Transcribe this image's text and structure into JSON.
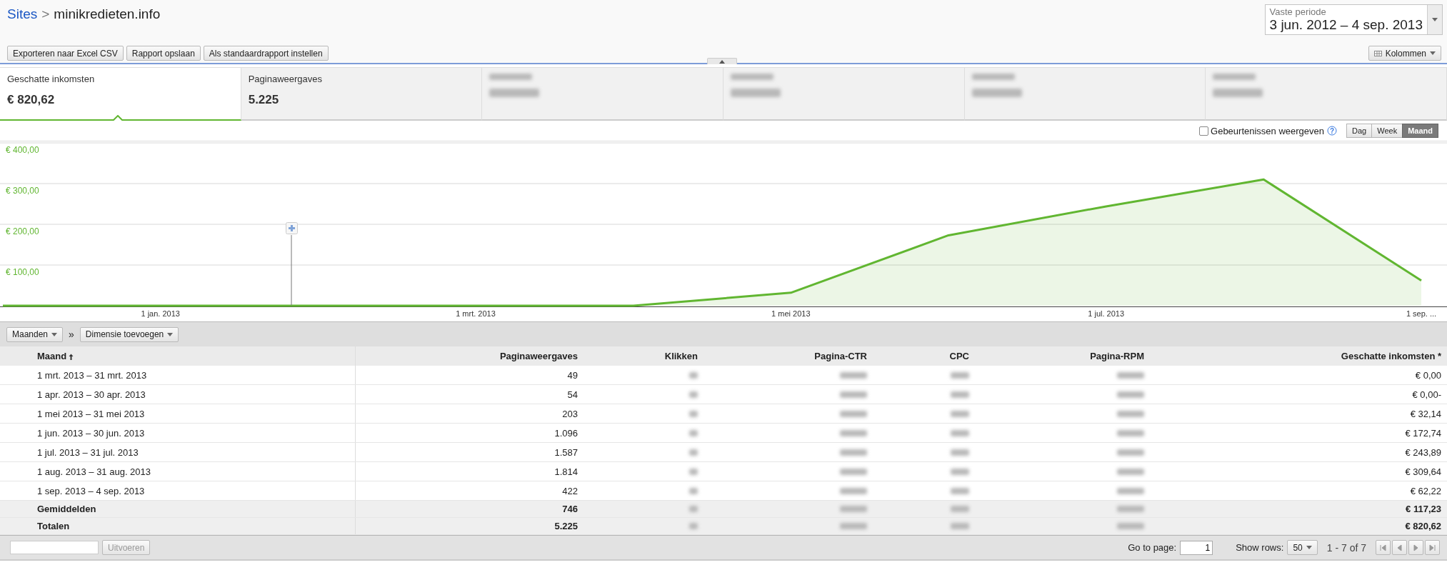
{
  "breadcrumb": {
    "link": "Sites",
    "separator": ">",
    "current": "minikredieten.info"
  },
  "toolbar_buttons": [
    "Exporteren naar Excel CSV",
    "Rapport opslaan",
    "Als standaardrapport instellen"
  ],
  "date_range": {
    "label": "Vaste periode",
    "value": "3 jun. 2012 – 4 sep. 2013"
  },
  "columns_button": "Kolommen",
  "metric_tabs": [
    {
      "kind": "metric",
      "label": "Geschatte inkomsten",
      "value": "€ 820,62",
      "selected": true
    },
    {
      "kind": "metric",
      "label": "Paginaweergaves",
      "value": "5.225",
      "selected": false
    },
    {
      "kind": "redacted",
      "selected": false
    },
    {
      "kind": "redacted",
      "selected": false
    },
    {
      "kind": "redacted",
      "selected": false
    },
    {
      "kind": "redacted",
      "selected": false
    }
  ],
  "chart_toolbar": {
    "events_checkbox": {
      "label": "Gebeurtenissen weergeven",
      "checked": false
    },
    "granularity": [
      {
        "label": "Dag",
        "selected": false
      },
      {
        "label": "Week",
        "selected": false
      },
      {
        "label": "Maand",
        "selected": true
      }
    ],
    "help_icon": "?"
  },
  "chart": {
    "chart_data": {
      "type": "area",
      "categories": [
        null,
        "1 jan. 2013",
        null,
        "1 mrt. 2013",
        null,
        "1 mei 2013",
        null,
        "1 jul. 2013",
        null,
        "1 sep. ..."
      ],
      "series": [
        {
          "color": "#61b631",
          "values": [
            0,
            0,
            0,
            0,
            0,
            32,
            173,
            244,
            310,
            62
          ]
        }
      ],
      "ylim": [
        0,
        400
      ],
      "grid": true,
      "yticks": [
        {
          "value": 100,
          "label": "€ 100,00"
        },
        {
          "value": 200,
          "label": "€ 200,00"
        },
        {
          "value": 300,
          "label": "€ 300,00"
        },
        {
          "value": 400,
          "label": "€ 400,00"
        }
      ]
    }
  },
  "dimension_bar": {
    "dimension_button": "Maanden",
    "separator": "»",
    "add_button": "Dimensie toevoegen"
  },
  "table": {
    "columns": [
      {
        "label": "Maand",
        "kind": "text",
        "sorted": true
      },
      {
        "label": "Paginaweergaves",
        "kind": "number",
        "sorted": false
      },
      {
        "label": "Klikken",
        "kind": "redacted",
        "sorted": false
      },
      {
        "label": "Pagina-CTR",
        "kind": "redacted",
        "sorted": false
      },
      {
        "label": "CPC",
        "kind": "redacted",
        "sorted": false
      },
      {
        "label": "Pagina-RPM",
        "kind": "redacted",
        "sorted": false
      },
      {
        "label": "Geschatte inkomsten *",
        "kind": "number",
        "sorted": false
      }
    ],
    "rows": [
      {
        "kind": "data",
        "cells": [
          "1 mrt. 2013 – 31 mrt. 2013",
          "49",
          "€ 0,00"
        ]
      },
      {
        "kind": "data",
        "cells": [
          "1 apr. 2013 – 30 apr. 2013",
          "54",
          "€ 0,00-"
        ]
      },
      {
        "kind": "data",
        "cells": [
          "1 mei 2013 – 31 mei 2013",
          "203",
          "€ 32,14"
        ]
      },
      {
        "kind": "data",
        "cells": [
          "1 jun. 2013 – 30 jun. 2013",
          "1.096",
          "€ 172,74"
        ]
      },
      {
        "kind": "data",
        "cells": [
          "1 jul. 2013 – 31 jul. 2013",
          "1.587",
          "€ 243,89"
        ]
      },
      {
        "kind": "data",
        "cells": [
          "1 aug. 2013 – 31 aug. 2013",
          "1.814",
          "€ 309,64"
        ]
      },
      {
        "kind": "data",
        "cells": [
          "1 sep. 2013 – 4 sep. 2013",
          "422",
          "€ 62,22"
        ]
      },
      {
        "kind": "summary",
        "cells": [
          "Gemiddelden",
          "746",
          "€ 117,23"
        ]
      },
      {
        "kind": "summary",
        "cells": [
          "Totalen",
          "5.225",
          "€ 820,62"
        ]
      }
    ]
  },
  "footer": {
    "filter_button": {
      "label": "Uitvoeren",
      "disabled": true
    },
    "go_to_page_label": "Go to page:",
    "page": "1",
    "show_rows_label": "Show rows:",
    "rows_per_page": "50",
    "range": "1 - 7 of 7"
  }
}
